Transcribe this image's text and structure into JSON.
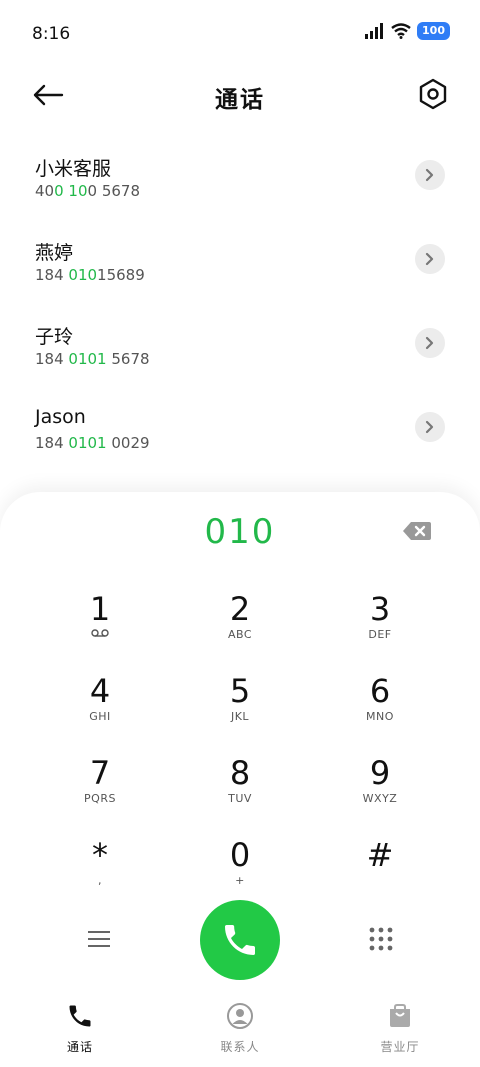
{
  "status_bar": {
    "time": "8:16",
    "battery": "100"
  },
  "header": {
    "title": "通话"
  },
  "contacts": [
    {
      "name": "小米客服",
      "number_parts": [
        {
          "t": "40",
          "m": false
        },
        {
          "t": "0",
          "m": true
        },
        {
          "t": " ",
          "m": false
        },
        {
          "t": "10",
          "m": true
        },
        {
          "t": "0 5678",
          "m": false
        }
      ]
    },
    {
      "name": "燕婷",
      "number_parts": [
        {
          "t": "184 ",
          "m": false
        },
        {
          "t": "010",
          "m": true
        },
        {
          "t": "15689",
          "m": false
        }
      ]
    },
    {
      "name": "子玲",
      "number_parts": [
        {
          "t": "184 ",
          "m": false
        },
        {
          "t": "0101",
          "m": true
        },
        {
          "t": " 5678",
          "m": false
        }
      ]
    },
    {
      "name": "Jason",
      "number_parts": [
        {
          "t": "184 ",
          "m": false
        },
        {
          "t": "0101",
          "m": true
        },
        {
          "t": " 0029",
          "m": false
        }
      ]
    }
  ],
  "dialer": {
    "dialed_number": "010",
    "keys": [
      {
        "digit": "1",
        "letters": "voicemail"
      },
      {
        "digit": "2",
        "letters": "ABC"
      },
      {
        "digit": "3",
        "letters": "DEF"
      },
      {
        "digit": "4",
        "letters": "GHI"
      },
      {
        "digit": "5",
        "letters": "JKL"
      },
      {
        "digit": "6",
        "letters": "MNO"
      },
      {
        "digit": "7",
        "letters": "PQRS"
      },
      {
        "digit": "8",
        "letters": "TUV"
      },
      {
        "digit": "9",
        "letters": "WXYZ"
      },
      {
        "digit": "*",
        "letters": ","
      },
      {
        "digit": "0",
        "letters": "+"
      },
      {
        "digit": "#",
        "letters": ""
      }
    ]
  },
  "bottom_nav": [
    {
      "label": "通话",
      "icon": "phone-icon",
      "active": true
    },
    {
      "label": "联系人",
      "icon": "person-icon",
      "active": false
    },
    {
      "label": "营业厅",
      "icon": "shop-bag-icon",
      "active": false
    }
  ],
  "colors": {
    "accent": "#22b84a",
    "call_button": "#22c946",
    "battery": "#2f7df6"
  }
}
